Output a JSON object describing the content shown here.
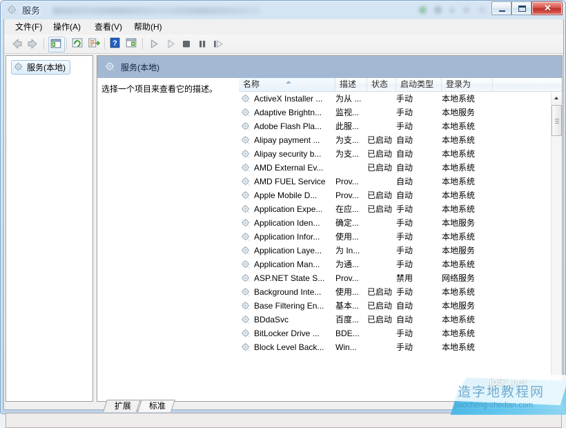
{
  "window": {
    "title": "服务",
    "title_icon": "services-gear-icon",
    "controls": {
      "minimize": "minimize-icon",
      "maximize": "restore-icon",
      "close": "✕"
    }
  },
  "menubar": {
    "items": [
      {
        "label": "文件(F)",
        "name": "menu-file"
      },
      {
        "label": "操作(A)",
        "name": "menu-action"
      },
      {
        "label": "查看(V)",
        "name": "menu-view"
      },
      {
        "label": "帮助(H)",
        "name": "menu-help"
      }
    ]
  },
  "toolbar": {
    "items": [
      {
        "name": "back-icon",
        "enabled": false
      },
      {
        "name": "forward-icon",
        "enabled": false
      },
      {
        "name": "show-hide-console-tree-icon",
        "enabled": true
      },
      {
        "name": "refresh-icon",
        "enabled": true
      },
      {
        "name": "export-list-icon",
        "enabled": true
      },
      {
        "name": "help-icon",
        "enabled": true
      },
      {
        "name": "show-hide-action-pane-icon",
        "enabled": true
      },
      {
        "name": "start-service-icon",
        "enabled": false
      },
      {
        "name": "resume-service-icon",
        "enabled": false
      },
      {
        "name": "stop-service-icon",
        "enabled": false
      },
      {
        "name": "pause-service-icon",
        "enabled": false
      },
      {
        "name": "restart-service-icon",
        "enabled": false
      }
    ]
  },
  "sidebar": {
    "tree_item": {
      "label": "服务(本地)",
      "icon": "services-gear-icon",
      "selected": true
    }
  },
  "pane": {
    "header": {
      "title": "服务(本地)",
      "icon": "services-gear-icon"
    },
    "description_placeholder": "选择一个项目来查看它的描述。"
  },
  "list": {
    "columns": [
      {
        "label": "名称",
        "name": "column-name",
        "sorted": "asc"
      },
      {
        "label": "描述",
        "name": "column-description"
      },
      {
        "label": "状态",
        "name": "column-status"
      },
      {
        "label": "启动类型",
        "name": "column-startup-type"
      },
      {
        "label": "登录为",
        "name": "column-log-on-as"
      }
    ],
    "rows": [
      {
        "name": "ActiveX Installer ...",
        "desc": "为从 ...",
        "status": "",
        "startup": "手动",
        "logon": "本地系统"
      },
      {
        "name": "Adaptive Brightn...",
        "desc": "监视...",
        "status": "",
        "startup": "手动",
        "logon": "本地服务"
      },
      {
        "name": "Adobe Flash Pla...",
        "desc": "此服...",
        "status": "",
        "startup": "手动",
        "logon": "本地系统"
      },
      {
        "name": "Alipay payment ...",
        "desc": "为支...",
        "status": "已启动",
        "startup": "自动",
        "logon": "本地系统"
      },
      {
        "name": "Alipay security b...",
        "desc": "为支...",
        "status": "已启动",
        "startup": "自动",
        "logon": "本地系统"
      },
      {
        "name": "AMD External Ev...",
        "desc": "",
        "status": "已启动",
        "startup": "自动",
        "logon": "本地系统"
      },
      {
        "name": "AMD FUEL Service",
        "desc": "Prov...",
        "status": "",
        "startup": "自动",
        "logon": "本地系统"
      },
      {
        "name": "Apple Mobile D...",
        "desc": "Prov...",
        "status": "已启动",
        "startup": "自动",
        "logon": "本地系统"
      },
      {
        "name": "Application Expe...",
        "desc": "在应...",
        "status": "已启动",
        "startup": "手动",
        "logon": "本地系统"
      },
      {
        "name": "Application Iden...",
        "desc": "确定...",
        "status": "",
        "startup": "手动",
        "logon": "本地服务"
      },
      {
        "name": "Application Infor...",
        "desc": "使用...",
        "status": "",
        "startup": "手动",
        "logon": "本地系统"
      },
      {
        "name": "Application Laye...",
        "desc": "为 In...",
        "status": "",
        "startup": "手动",
        "logon": "本地服务"
      },
      {
        "name": "Application Man...",
        "desc": "为通...",
        "status": "",
        "startup": "手动",
        "logon": "本地系统"
      },
      {
        "name": "ASP.NET State S...",
        "desc": "Prov...",
        "status": "",
        "startup": "禁用",
        "logon": "网络服务"
      },
      {
        "name": "Background Inte...",
        "desc": "使用...",
        "status": "已启动",
        "startup": "手动",
        "logon": "本地系统"
      },
      {
        "name": "Base Filtering En...",
        "desc": "基本...",
        "status": "已启动",
        "startup": "自动",
        "logon": "本地服务"
      },
      {
        "name": "BDdaSvc",
        "desc": "百度...",
        "status": "已启动",
        "startup": "自动",
        "logon": "本地系统"
      },
      {
        "name": "BitLocker Drive ...",
        "desc": "BDE...",
        "status": "",
        "startup": "手动",
        "logon": "本地系统"
      },
      {
        "name": "Block Level Back...",
        "desc": "Win...",
        "status": "",
        "startup": "手动",
        "logon": "本地系统"
      }
    ]
  },
  "tabs": [
    {
      "label": "扩展",
      "name": "tab-extended",
      "active": false
    },
    {
      "label": "标准",
      "name": "tab-standard",
      "active": true
    }
  ],
  "statusbar": {
    "text": ""
  },
  "watermark": {
    "cn_text": "造字地教程网",
    "en_text": "jb51.net",
    "url_text": "jiaocheng-chedian.com"
  },
  "colors": {
    "accent": "#a3b8d2",
    "close_button": "#bd2f27",
    "window_border": "#6f9dc9"
  }
}
